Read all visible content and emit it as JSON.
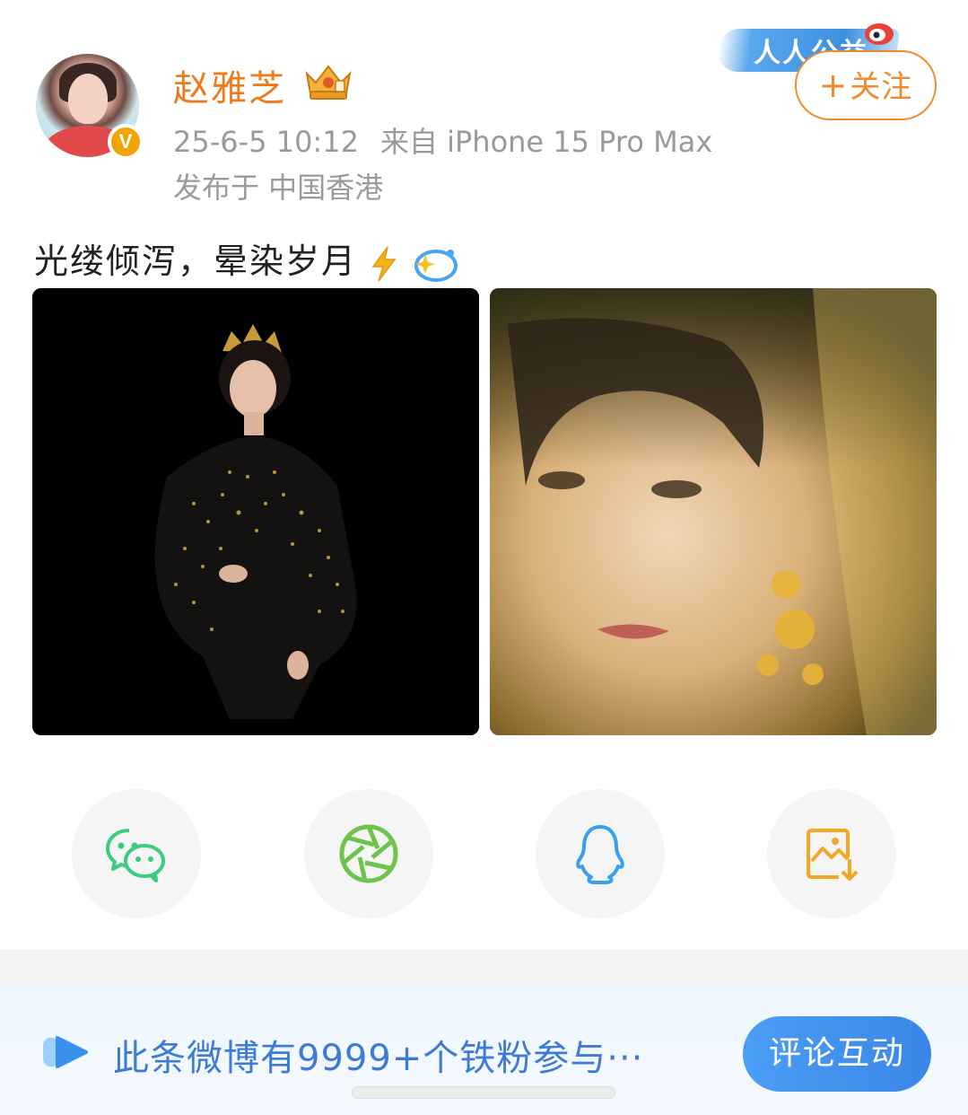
{
  "header": {
    "username": "赵雅芝",
    "timestamp": "25-6-5 10:12",
    "source": "来自 iPhone 15 Pro Max",
    "location": "发布于 中国香港",
    "verified_badge": "V",
    "follow_label": "关注",
    "follow_plus": "+",
    "sticker_text": "人人公益"
  },
  "post": {
    "text": "光缕倾泻，晕染岁月",
    "emojis": [
      "lightning-icon",
      "sparkle-orb-icon"
    ]
  },
  "share": {
    "items": [
      {
        "icon": "wechat-icon"
      },
      {
        "icon": "moments-icon"
      },
      {
        "icon": "qq-icon"
      },
      {
        "icon": "save-image-icon"
      }
    ]
  },
  "bottom_bar": {
    "message": "此条微博有9999+个铁粉参与···",
    "cta_label": "评论互动"
  },
  "colors": {
    "accent_orange": "#ee7a1a",
    "wechat_green": "#3ccb7f",
    "moments_green": "#6cc54a",
    "qq_blue": "#3aa0ee",
    "save_orange": "#f5a623",
    "link_blue": "#3d7bd6"
  }
}
